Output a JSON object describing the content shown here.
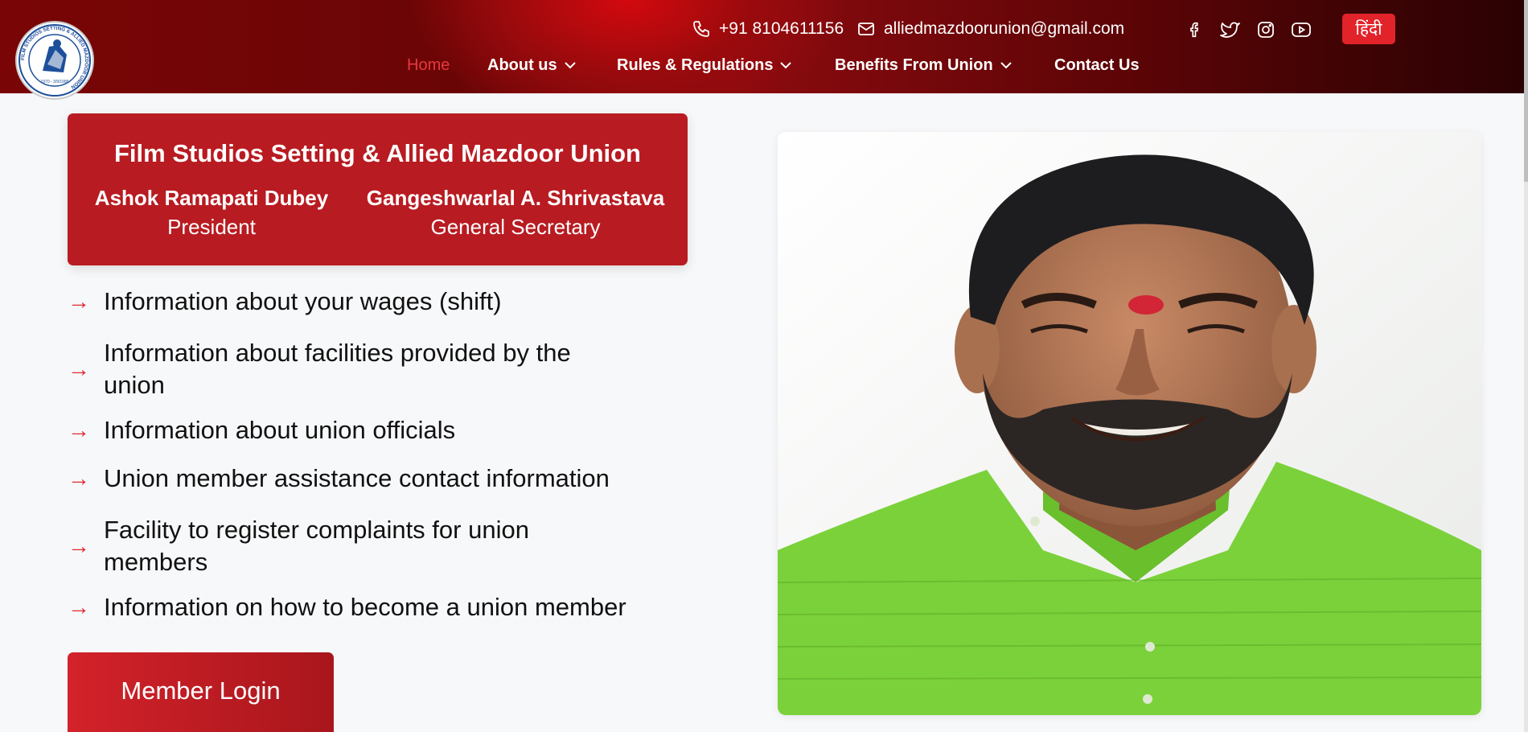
{
  "header": {
    "phone": "+91 8104611156",
    "email": "alliedmazdoorunion@gmail.com",
    "language_button": "हिंदी",
    "logo": {
      "ring_text": "FILM STUDIOS SETTING & ALLIED MAZDOOR UNION",
      "year_text": "1970 - 3/9/1985"
    },
    "social_icons": [
      "facebook-icon",
      "twitter-icon",
      "instagram-icon",
      "youtube-icon"
    ],
    "nav": [
      {
        "label": "Home",
        "active": true,
        "dropdown": false
      },
      {
        "label": "About us",
        "active": false,
        "dropdown": true
      },
      {
        "label": "Rules & Regulations",
        "active": false,
        "dropdown": true
      },
      {
        "label": "Benefits From Union",
        "active": false,
        "dropdown": true
      },
      {
        "label": "Contact Us",
        "active": false,
        "dropdown": false
      }
    ]
  },
  "hero": {
    "union_name": "Film Studios Setting & Allied Mazdoor Union",
    "officers": [
      {
        "name": "Ashok Ramapati Dubey",
        "role": "President"
      },
      {
        "name": "Gangeshwarlal A. Shrivastava",
        "role": "General Secretary"
      }
    ],
    "features": [
      {
        "line1": "Information about your wages (shift)",
        "line2": ""
      },
      {
        "line1": "Information about facilities provided by the",
        "line2": "union"
      },
      {
        "line1": "Information about union officials",
        "line2": ""
      },
      {
        "line1": "Union member assistance contact information",
        "line2": ""
      },
      {
        "line1": "Facility to register complaints for union",
        "line2": "members"
      },
      {
        "line1": "Information on how to become a union member",
        "line2": ""
      }
    ],
    "arrow_glyph": "→",
    "login_button": "Member Login"
  },
  "colors": {
    "brand_red": "#b81b21",
    "accent_red": "#e2232a",
    "header_dark": "#6a0506",
    "background": "#f7f8fa"
  }
}
